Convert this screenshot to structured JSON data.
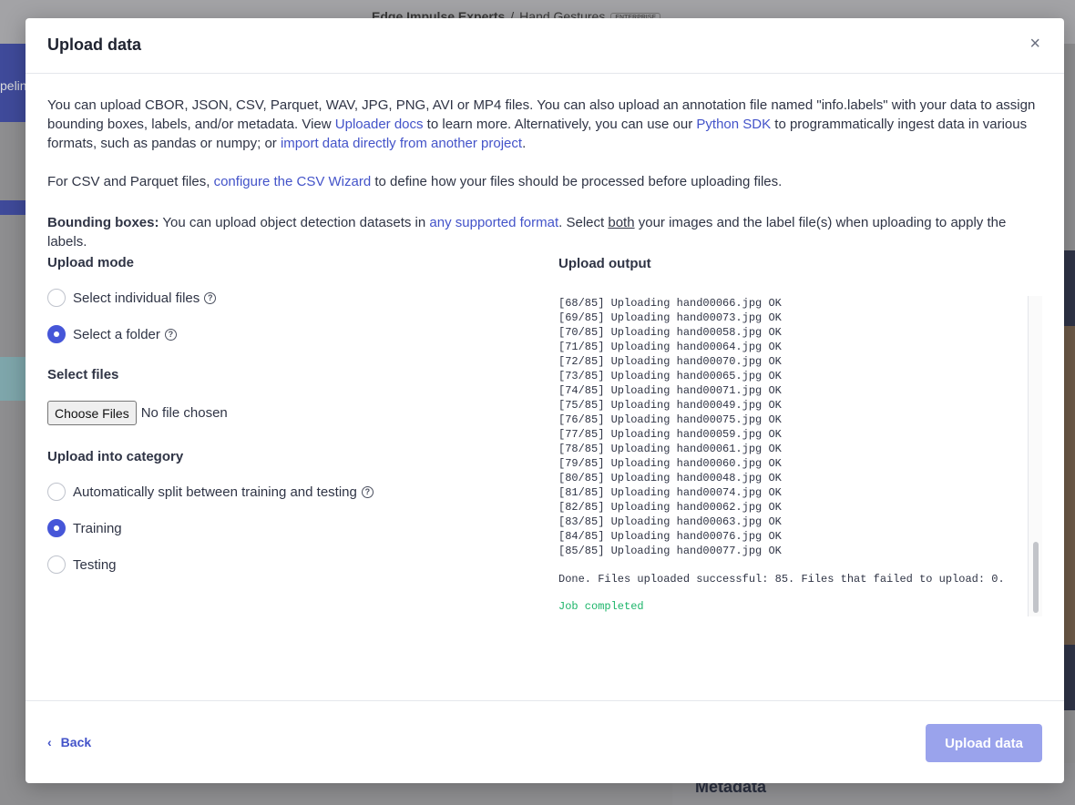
{
  "background": {
    "breadcrumb_org": "Edge Impulse Experts",
    "breadcrumb_sep": "/",
    "breadcrumb_project": "Hand Gestures",
    "breadcrumb_badge": "ENTERPRISE",
    "nav_fragment": "pelin",
    "metadata_heading": "Metadata"
  },
  "modal": {
    "title": "Upload data",
    "close_glyph": "×",
    "intro": {
      "t1": "You can upload CBOR, JSON, CSV, Parquet, WAV, JPG, PNG, AVI or MP4 files. You can also upload an annotation file named \"info.labels\" with your data to assign bounding boxes, labels, and/or metadata. View ",
      "link_uploader": "Uploader docs",
      "t2": " to learn more. Alternatively, you can use our ",
      "link_sdk": "Python SDK",
      "t3": " to programmatically ingest data in various formats, such as pandas or numpy; or ",
      "link_import": "import data directly from another project",
      "t4": "."
    },
    "csv": {
      "t1": "For CSV and Parquet files, ",
      "link_wizard": "configure the CSV Wizard",
      "t2": " to define how your files should be processed before uploading files."
    },
    "bbox": {
      "bold": "Bounding boxes:",
      "t1": " You can upload object detection datasets in ",
      "link_format": "any supported format",
      "t2": ". Select ",
      "underlined": "both",
      "t3": " your images and the label file(s) when uploading to apply the labels."
    },
    "upload_mode": {
      "label": "Upload mode",
      "options": [
        {
          "label": "Select individual files",
          "checked": false
        },
        {
          "label": "Select a folder",
          "checked": true
        }
      ]
    },
    "select_files": {
      "label": "Select files",
      "button": "Choose Files",
      "status": "No file chosen"
    },
    "category": {
      "label": "Upload into category",
      "options": [
        {
          "label": "Automatically split between training and testing",
          "checked": false
        },
        {
          "label": "Training",
          "checked": true
        },
        {
          "label": "Testing",
          "checked": false
        }
      ]
    },
    "output": {
      "label": "Upload output",
      "lines": [
        "[68/85] Uploading hand00066.jpg OK",
        "[69/85] Uploading hand00073.jpg OK",
        "[70/85] Uploading hand00058.jpg OK",
        "[71/85] Uploading hand00064.jpg OK",
        "[72/85] Uploading hand00070.jpg OK",
        "[73/85] Uploading hand00065.jpg OK",
        "[74/85] Uploading hand00071.jpg OK",
        "[75/85] Uploading hand00049.jpg OK",
        "[76/85] Uploading hand00075.jpg OK",
        "[77/85] Uploading hand00059.jpg OK",
        "[78/85] Uploading hand00061.jpg OK",
        "[79/85] Uploading hand00060.jpg OK",
        "[80/85] Uploading hand00048.jpg OK",
        "[81/85] Uploading hand00074.jpg OK",
        "[82/85] Uploading hand00062.jpg OK",
        "[83/85] Uploading hand00063.jpg OK",
        "[84/85] Uploading hand00076.jpg OK",
        "[85/85] Uploading hand00077.jpg OK"
      ],
      "done": "Done. Files uploaded successful: 85. Files that failed to upload: 0.",
      "job": "Job completed",
      "job_color": "#1db56a"
    },
    "footer": {
      "back_glyph": "‹",
      "back_label": "Back",
      "submit_label": "Upload data"
    }
  },
  "colors": {
    "accent": "#4656d8",
    "link": "#4353c9",
    "submit_disabled": "#9aa3ec"
  },
  "icons": {
    "help": "question-circle-icon",
    "close": "close-icon",
    "back": "chevron-left-icon"
  }
}
